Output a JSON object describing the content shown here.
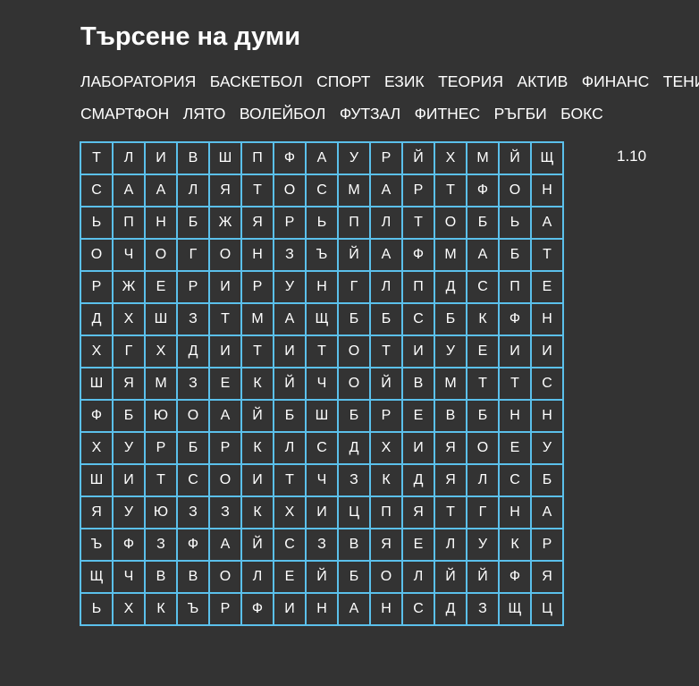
{
  "title": "Търсене на думи",
  "word_rows": [
    [
      "ЛАБОРАТОРИЯ",
      "БАСКЕТБОЛ",
      "СПОРТ",
      "ЕЗИК",
      "ТЕОРИЯ",
      "АКТИВ",
      "ФИНАНС",
      "ТЕНИС"
    ],
    [
      "СМАРТФОН",
      "ЛЯТО",
      "ВОЛЕЙБОЛ",
      "ФУТЗАЛ",
      "ФИТНЕС",
      "РЪГБИ",
      "БОКС"
    ]
  ],
  "grid": [
    [
      "Т",
      "Л",
      "И",
      "В",
      "Ш",
      "П",
      "Ф",
      "А",
      "У",
      "Р",
      "Й",
      "Х",
      "М",
      "Й",
      "Щ"
    ],
    [
      "С",
      "А",
      "А",
      "Л",
      "Я",
      "Т",
      "О",
      "С",
      "М",
      "А",
      "Р",
      "Т",
      "Ф",
      "О",
      "Н"
    ],
    [
      "Ь",
      "П",
      "Н",
      "Б",
      "Ж",
      "Я",
      "Р",
      "Ь",
      "П",
      "Л",
      "Т",
      "О",
      "Б",
      "Ь",
      "А"
    ],
    [
      "О",
      "Ч",
      "О",
      "Г",
      "О",
      "Н",
      "З",
      "Ъ",
      "Й",
      "А",
      "Ф",
      "М",
      "А",
      "Б",
      "Т"
    ],
    [
      "Р",
      "Ж",
      "Е",
      "Р",
      "И",
      "Р",
      "У",
      "Н",
      "Г",
      "Л",
      "П",
      "Д",
      "С",
      "П",
      "Е"
    ],
    [
      "Д",
      "Х",
      "Ш",
      "З",
      "Т",
      "М",
      "А",
      "Щ",
      "Б",
      "Б",
      "С",
      "Б",
      "К",
      "Ф",
      "Н"
    ],
    [
      "Х",
      "Г",
      "Х",
      "Д",
      "И",
      "Т",
      "И",
      "Т",
      "О",
      "Т",
      "И",
      "У",
      "Е",
      "И",
      "И"
    ],
    [
      "Ш",
      "Я",
      "М",
      "З",
      "Е",
      "К",
      "Й",
      "Ч",
      "О",
      "Й",
      "В",
      "М",
      "Т",
      "Т",
      "С"
    ],
    [
      "Ф",
      "Б",
      "Ю",
      "О",
      "А",
      "Й",
      "Б",
      "Ш",
      "Б",
      "Р",
      "Е",
      "В",
      "Б",
      "Н",
      "Н"
    ],
    [
      "Х",
      "У",
      "Р",
      "Б",
      "Р",
      "К",
      "Л",
      "С",
      "Д",
      "Х",
      "И",
      "Я",
      "О",
      "Е",
      "У"
    ],
    [
      "Ш",
      "И",
      "Т",
      "С",
      "О",
      "И",
      "Т",
      "Ч",
      "З",
      "К",
      "Д",
      "Я",
      "Л",
      "С",
      "Б"
    ],
    [
      "Я",
      "У",
      "Ю",
      "З",
      "З",
      "К",
      "Х",
      "И",
      "Ц",
      "П",
      "Я",
      "Т",
      "Г",
      "Н",
      "А"
    ],
    [
      "Ъ",
      "Ф",
      "З",
      "Ф",
      "А",
      "Й",
      "С",
      "З",
      "В",
      "Я",
      "Е",
      "Л",
      "У",
      "К",
      "Р"
    ],
    [
      "Щ",
      "Ч",
      "В",
      "В",
      "О",
      "Л",
      "Е",
      "Й",
      "Б",
      "О",
      "Л",
      "Й",
      "Й",
      "Ф",
      "Я"
    ],
    [
      "Ь",
      "Х",
      "К",
      "Ъ",
      "Р",
      "Ф",
      "И",
      "Н",
      "А",
      "Н",
      "С",
      "Д",
      "З",
      "Щ",
      "Ц"
    ]
  ],
  "counter": "1.10",
  "colors": {
    "background": "#333333",
    "text": "#ffffff",
    "grid_border": "#5bc0eb"
  }
}
